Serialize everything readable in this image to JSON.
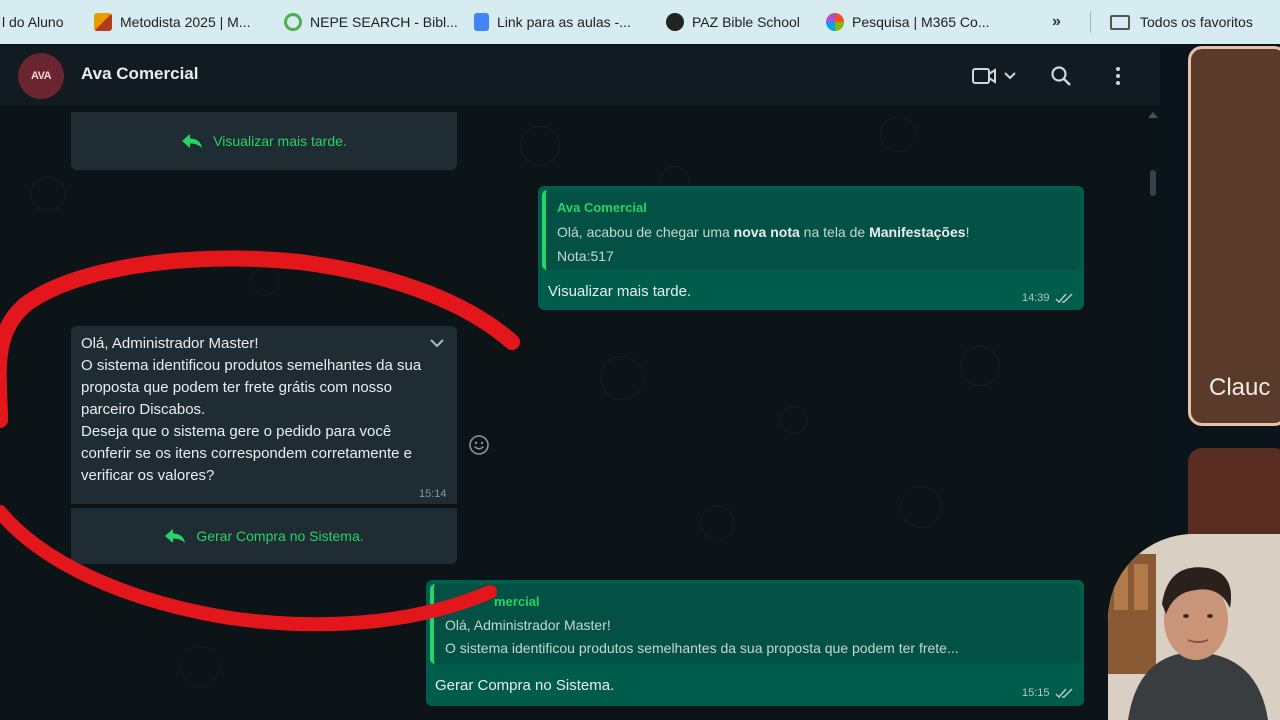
{
  "bookmarks": [
    {
      "label": "l do Aluno",
      "icon": "bookmark-icon",
      "color": "#d6ecf0"
    },
    {
      "label": "Metodista 2025 | M...",
      "icon": "metodista-icon",
      "color": "#d98c00"
    },
    {
      "label": "NEPE SEARCH - Bibl...",
      "icon": "search-globe-icon",
      "color": "#4caf50"
    },
    {
      "label": "Link para as aulas -...",
      "icon": "google-docs-icon",
      "color": "#4285f4"
    },
    {
      "label": "PAZ Bible School",
      "icon": "globe-icon",
      "color": "#222222"
    },
    {
      "label": "Pesquisa | M365 Co...",
      "icon": "m365-copilot-icon",
      "color": "#b04fd6"
    }
  ],
  "bookmarks_more": "»",
  "bookmarks_folder": "Todos os favoritos",
  "chat": {
    "avatar_text": "AVA",
    "title": "Ava Comercial"
  },
  "messages": {
    "top_button": "Visualizar mais tarde.",
    "out1": {
      "quote_title": "Ava Comercial",
      "quote_line1_pre": "Olá, acabou de chegar uma ",
      "quote_line1_bold1": "nova nota",
      "quote_line1_mid": " na tela de ",
      "quote_line1_bold2": "Manifestações",
      "quote_line1_post": "!",
      "quote_line2": "Nota:517",
      "text": "Visualizar mais tarde.",
      "time": "14:39"
    },
    "in1": {
      "lines": [
        "Olá, Administrador Master!",
        "O sistema identificou produtos semelhantes da sua",
        "proposta que podem ter frete grátis com nosso",
        "parceiro Discabos.",
        "Deseja que o sistema gere o pedido para você",
        "conferir se os itens correspondem corretamente e",
        "verificar os valores?"
      ],
      "time": "15:14",
      "button": "Gerar Compra no Sistema."
    },
    "out2": {
      "quote_title": "mercial",
      "quote_line1": "Olá, Administrador Master!",
      "quote_line2": "O sistema identificou produtos semelhantes da sua proposta que podem ter frete...",
      "text": "Gerar Compra no Sistema.",
      "time": "15:15"
    }
  },
  "side": {
    "name_fragment": "Clauc"
  },
  "colors": {
    "accent_green": "#25d366",
    "outgoing_bubble": "#005c4b",
    "incoming_bubble": "#202c33",
    "annotation_red": "#e3161b"
  }
}
